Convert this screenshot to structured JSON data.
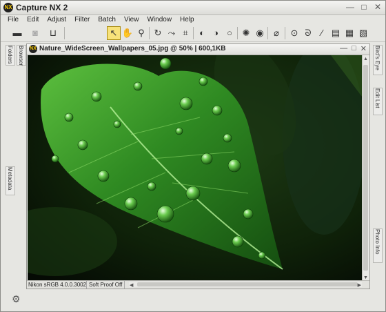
{
  "app": {
    "title": "Capture NX 2",
    "logo_text": "NX"
  },
  "window_controls": {
    "minimize": "—",
    "restore": "□",
    "close": "✕"
  },
  "menu": [
    "File",
    "Edit",
    "Adjust",
    "Filter",
    "Batch",
    "View",
    "Window",
    "Help"
  ],
  "document": {
    "title": "Nature_WideScreen_Wallpapers_05.jpg @ 50%  |  600,1KB",
    "controls": {
      "minimize": "—",
      "restore": "□",
      "close": "✕"
    }
  },
  "status": {
    "profile": "Nikon sRGB 4.0.0.3002",
    "soft_proof": "Soft Proof Off"
  },
  "left_panel": {
    "tabs": [
      "Folders",
      "Browser",
      "Metadata"
    ]
  },
  "right_panel": {
    "tabs": [
      "Bird's Eye",
      "Edit List",
      "Photo Info"
    ]
  },
  "colors": {
    "accent_active_tool": "#f7e27a",
    "leaf_green": "#3c9a2c"
  }
}
